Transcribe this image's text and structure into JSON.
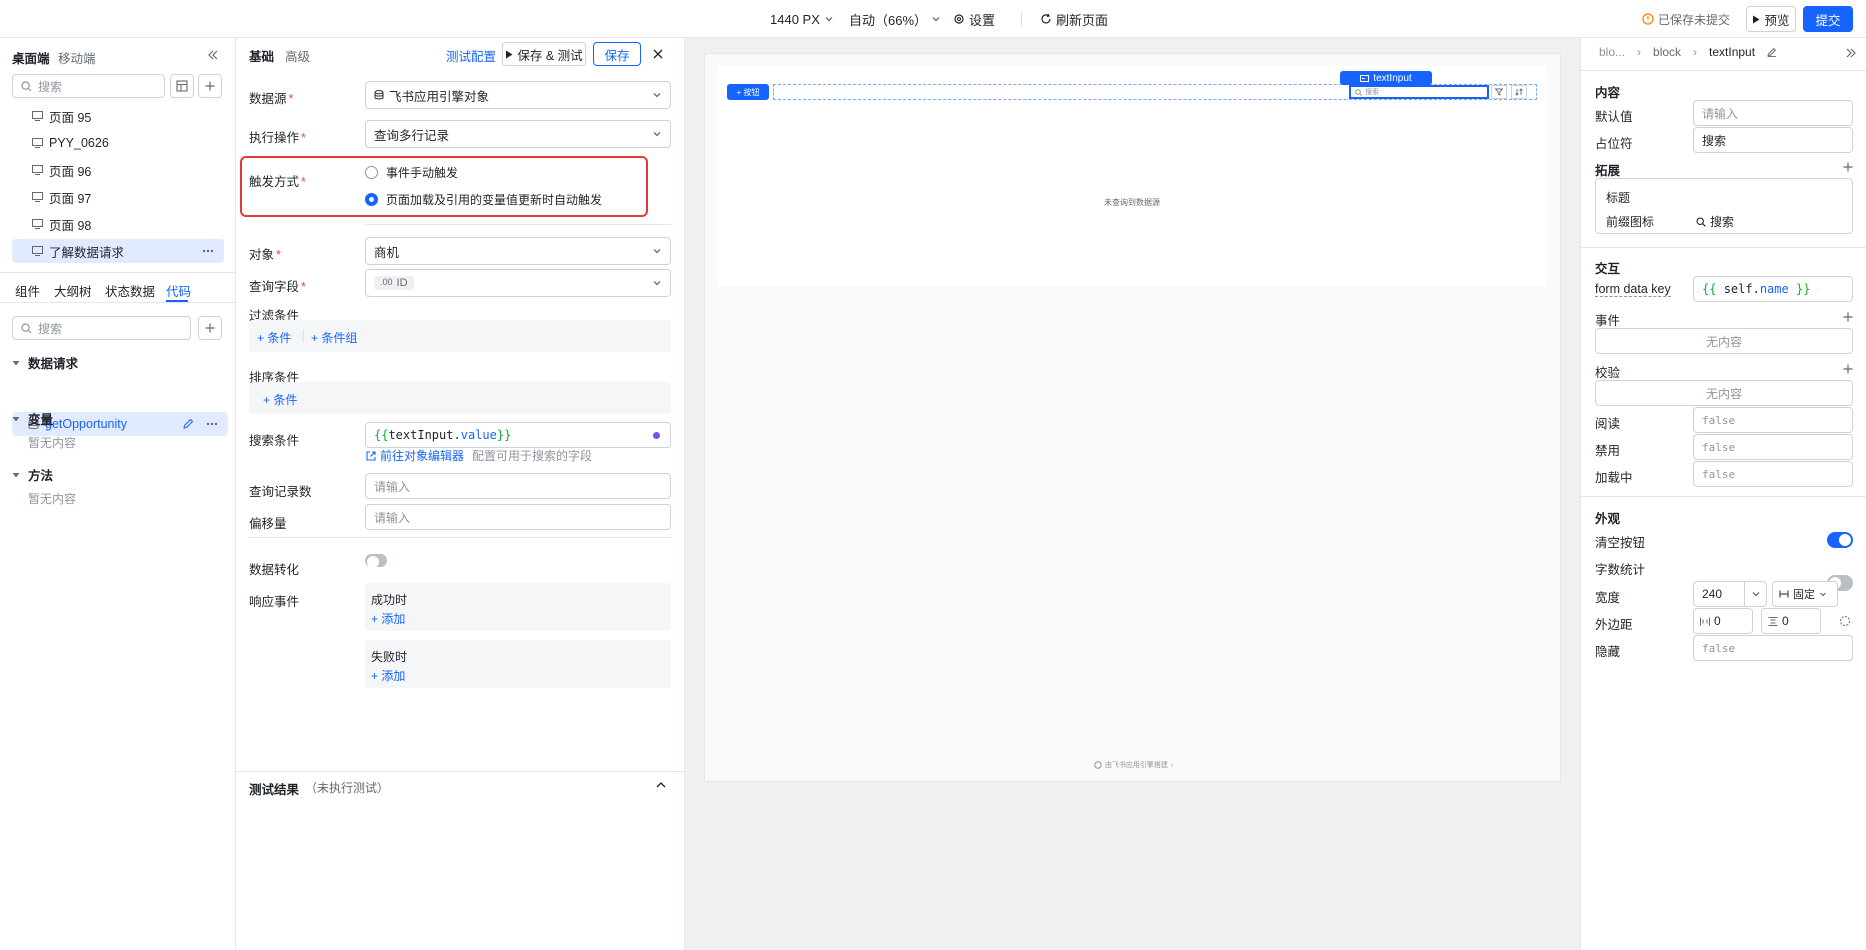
{
  "topbar": {
    "width_label": "1440 PX",
    "zoom_label": "自动（66%）",
    "settings_label": "设置",
    "refresh_label": "刷新页面",
    "unsaved_label": "已保存未提交",
    "preview_label": "预览",
    "submit_label": "提交"
  },
  "left": {
    "tabs_top": [
      "桌面端",
      "移动端"
    ],
    "search_placeholder": "搜索",
    "pages": [
      "页面 95",
      "PYY_0626",
      "页面 96",
      "页面 97",
      "页面 98",
      "了解数据请求"
    ],
    "tabs_bottom": [
      "组件",
      "大纲树",
      "状态数据",
      "代码"
    ],
    "search2_placeholder": "搜索",
    "sections": {
      "data_request": "数据请求",
      "request_item": "getOpportunity",
      "variables": "变量",
      "variables_empty": "暂无内容",
      "methods": "方法",
      "methods_empty": "暂无内容"
    }
  },
  "mid": {
    "tabs": [
      "基础",
      "高级"
    ],
    "test_config": "测试配置",
    "save_test": "保存 & 测试",
    "save": "保存",
    "datasource_label": "数据源",
    "datasource_value": "飞书应用引擎对象",
    "action_label": "执行操作",
    "action_value": "查询多行记录",
    "trigger_label": "触发方式",
    "trigger_opt1": "事件手动触发",
    "trigger_opt2": "页面加载及引用的变量值更新时自动触发",
    "object_label": "对象",
    "object_value": "商机",
    "fields_label": "查询字段",
    "fields_tag_prefix": ".00",
    "fields_tag": "ID",
    "filter_label": "过滤条件",
    "filter_add_condition": "条件",
    "filter_add_group": "条件组",
    "sort_label": "排序条件",
    "sort_add": "条件",
    "search_label": "搜索条件",
    "search_open": "{{",
    "search_var": "textInput",
    "search_dot": ".",
    "search_prop": "value",
    "search_close": "}}",
    "goto_editor": "前往对象编辑器",
    "goto_hint": "配置可用于搜索的字段",
    "count_label": "查询记录数",
    "count_placeholder": "请输入",
    "offset_label": "偏移量",
    "offset_placeholder": "请输入",
    "transform_label": "数据转化",
    "events_label": "响应事件",
    "on_success": "成功时",
    "on_fail": "失败时",
    "add_label": "添加",
    "result_label": "测试结果",
    "result_status": "（未执行测试）"
  },
  "canvas": {
    "button_label": "+ 按钮",
    "selected_tag": "textInput",
    "search_placeholder": "搜索",
    "empty_text": "未查询到数据源",
    "footer_text": "由飞书应用引擎搭建"
  },
  "right": {
    "breadcrumb": [
      "blo...",
      "block",
      "textInput"
    ],
    "content_title": "内容",
    "default_label": "默认值",
    "default_placeholder": "请输入",
    "placeholder_label": "占位符",
    "placeholder_value": "搜索",
    "expand_label": "拓展",
    "title_label": "标题",
    "prefix_icon_label": "前缀图标",
    "prefix_icon_value": "搜索",
    "interaction_title": "交互",
    "form_key_label": "form data key",
    "form_key_open": "{{",
    "form_key_self": "self",
    "form_key_dot": ".",
    "form_key_name": "name",
    "form_key_close": "}}",
    "events_label": "事件",
    "events_empty": "无内容",
    "validate_label": "校验",
    "validate_empty": "无内容",
    "readonly_label": "阅读",
    "readonly_value": "false",
    "disabled_label": "禁用",
    "disabled_value": "false",
    "loading_label": "加载中",
    "loading_value": "false",
    "appearance_title": "外观",
    "clear_label": "清空按钮",
    "clear_on": true,
    "count_label": "字数统计",
    "count_on": false,
    "width_label": "宽度",
    "width_value": "240",
    "width_mode": "固定",
    "margin_label": "外边距",
    "margin_h": "0",
    "margin_v": "0",
    "hidden_label": "隐藏",
    "hidden_value": "false"
  },
  "colors": {
    "accent": "#1664ff",
    "highlight_border": "#e03a3a",
    "code_green": "#00b42a"
  }
}
